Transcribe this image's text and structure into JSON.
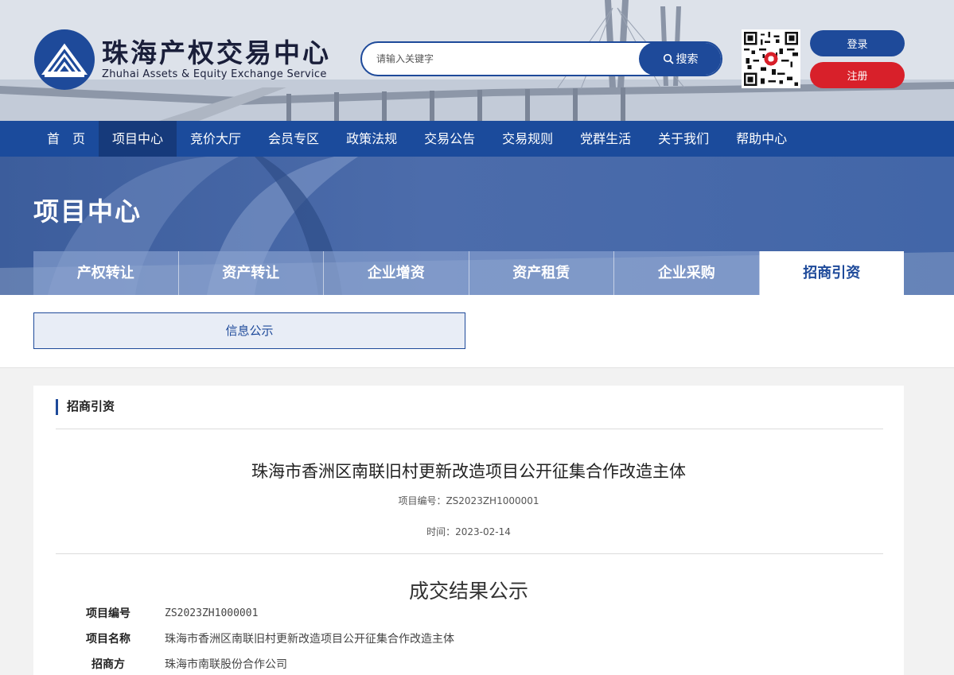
{
  "header": {
    "site_name": "珠海产权交易中心",
    "site_name_en": "Zhuhai Assets & Equity Exchange Service",
    "search_placeholder": "请输入关键字",
    "search_label": "搜索",
    "login_label": "登录",
    "register_label": "注册"
  },
  "nav": {
    "items": [
      "首　页",
      "项目中心",
      "竞价大厅",
      "会员专区",
      "政策法规",
      "交易公告",
      "交易规则",
      "党群生活",
      "关于我们",
      "帮助中心"
    ],
    "active_index": 1
  },
  "banner": {
    "title": "项目中心",
    "tabs": [
      "产权转让",
      "资产转让",
      "企业增资",
      "资产租赁",
      "企业采购",
      "招商引资"
    ],
    "active_tab_index": 5
  },
  "subtabs": [
    "信息公示"
  ],
  "content": {
    "section_label": "招商引资",
    "title": "珠海市香洲区南联旧村更新改造项目公开征集合作改造主体",
    "project_code_line": "项目编号：ZS2023ZH1000001",
    "time_line": "时间：2023-02-14",
    "result_title": "成交结果公示",
    "rows": [
      {
        "label": "项目编号",
        "value": "ZS2023ZH1000001"
      },
      {
        "label": "项目名称",
        "value": "珠海市香洲区南联旧村更新改造项目公开征集合作改造主体"
      },
      {
        "label": "招商方",
        "value": "珠海市南联股份合作公司"
      }
    ]
  },
  "colors": {
    "primary": "#1e4a9a",
    "nav_bg": "#1b4b9c",
    "register": "#d8202a"
  }
}
